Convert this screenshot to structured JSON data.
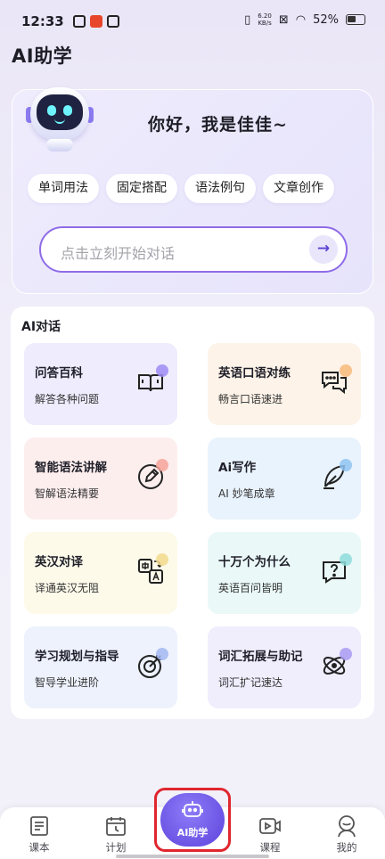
{
  "status_bar": {
    "time": "12:33",
    "net_speed_value": "6.20",
    "net_speed_unit": "KB/s",
    "battery": "52%"
  },
  "app": {
    "title": "AI助学"
  },
  "hero": {
    "greeting": "你好，我是佳佳~",
    "chips": [
      "单词用法",
      "固定搭配",
      "语法例句",
      "文章创作"
    ],
    "input_placeholder": "点击立刻开始对话",
    "send_glyph": "→"
  },
  "ai_dialog": {
    "title": "AI对话",
    "cards": [
      {
        "title": "问答百科",
        "subtitle": "解答各种问题",
        "icon": "open-book-icon",
        "bg": "#eeecfd",
        "accent": "#9d8cf3"
      },
      {
        "title": "英语口语对练",
        "subtitle": "畅言口语速进",
        "icon": "chat-bubbles-icon",
        "bg": "#fdf3e8",
        "accent": "#f7b97a"
      },
      {
        "title": "智能语法讲解",
        "subtitle": "智解语法精要",
        "icon": "pencil-circle-icon",
        "bg": "#fdeeee",
        "accent": "#f6a39a"
      },
      {
        "title": "Ai写作",
        "subtitle": "AI 妙笔成章",
        "icon": "feather-pen-icon",
        "bg": "#e9f3fd",
        "accent": "#8fc3f2"
      },
      {
        "title": "英汉对译",
        "subtitle": "译通英汉无阻",
        "icon": "translate-icon",
        "bg": "#fdfaea",
        "accent": "#f1d98c"
      },
      {
        "title": "十万个为什么",
        "subtitle": "英语百问皆明",
        "icon": "question-bubble-icon",
        "bg": "#eaf8f8",
        "accent": "#8edcdc"
      },
      {
        "title": "学习规划与指导",
        "subtitle": "智导学业进阶",
        "icon": "target-icon",
        "bg": "#edf2fd",
        "accent": "#a3b9f1"
      },
      {
        "title": "词汇拓展与助记",
        "subtitle": "词汇扩记速达",
        "icon": "atom-icon",
        "bg": "#f0edfd",
        "accent": "#a99bf3"
      }
    ]
  },
  "bottom_nav": {
    "items": [
      {
        "label": "课本",
        "icon": "textbook-icon"
      },
      {
        "label": "计划",
        "icon": "calendar-icon"
      },
      {
        "label": "AI助学",
        "icon": "robot-icon",
        "active": true
      },
      {
        "label": "课程",
        "icon": "video-course-icon"
      },
      {
        "label": "我的",
        "icon": "profile-icon"
      }
    ]
  },
  "colors": {
    "accent": "#5d43dc",
    "input_border": "#8f6be8",
    "highlight_box": "#e0262e"
  }
}
